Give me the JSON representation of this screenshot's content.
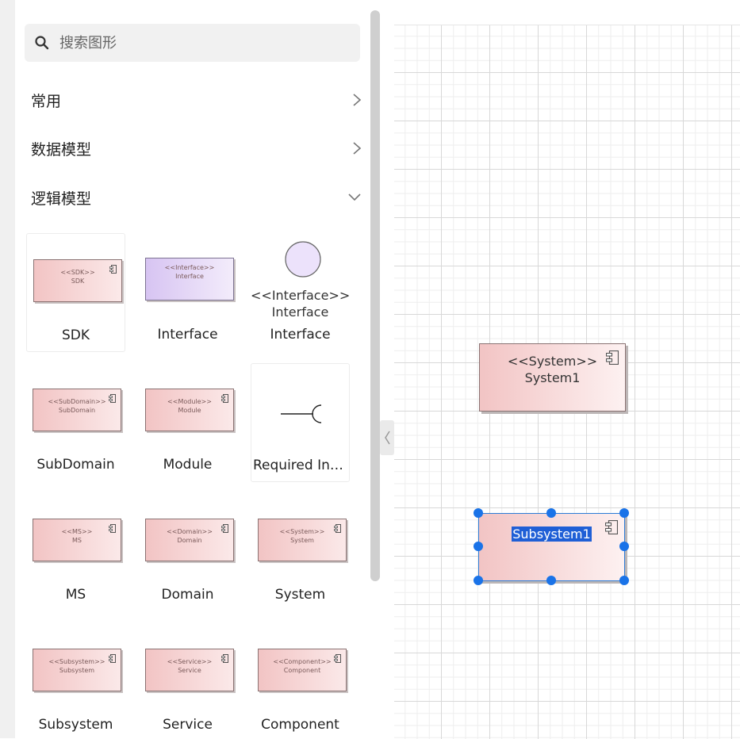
{
  "search": {
    "placeholder": "搜索图形"
  },
  "sections": [
    {
      "label": "常用",
      "state": "collapsed"
    },
    {
      "label": "数据模型",
      "state": "collapsed"
    },
    {
      "label": "逻辑模型",
      "state": "expanded"
    }
  ],
  "shapes": [
    {
      "label": "SDK",
      "stereotype": "<<SDK>>",
      "name": "SDK"
    },
    {
      "label": "Interface",
      "stereotype": "<<Interface>>",
      "name": "Interface"
    },
    {
      "label": "Interface",
      "stereotype": "<<Interface>>",
      "name": "Interface"
    },
    {
      "label": "SubDomain",
      "stereotype": "<<SubDomain>>",
      "name": "SubDomain"
    },
    {
      "label": "Module",
      "stereotype": "<<Module>>",
      "name": "Module"
    },
    {
      "label": "Required Int…"
    },
    {
      "label": "MS",
      "stereotype": "<<MS>>",
      "name": "MS"
    },
    {
      "label": "Domain",
      "stereotype": "<<Domain>>",
      "name": "Domain"
    },
    {
      "label": "System",
      "stereotype": "<<System>>",
      "name": "System"
    },
    {
      "label": "Subsystem",
      "stereotype": "<<Subsystem>>",
      "name": "Subsystem"
    },
    {
      "label": "Service",
      "stereotype": "<<Service>>",
      "name": "Service"
    },
    {
      "label": "Component",
      "stereotype": "<<Component>>",
      "name": "Component"
    }
  ],
  "canvas": {
    "system_node": {
      "stereotype": "<<System>>",
      "name": "System1"
    },
    "subsystem_node": {
      "name": "Subsystem1",
      "selected": true
    }
  },
  "colors": {
    "accent": "#1a73e8",
    "selection_text_bg": "#1f5fd6"
  }
}
